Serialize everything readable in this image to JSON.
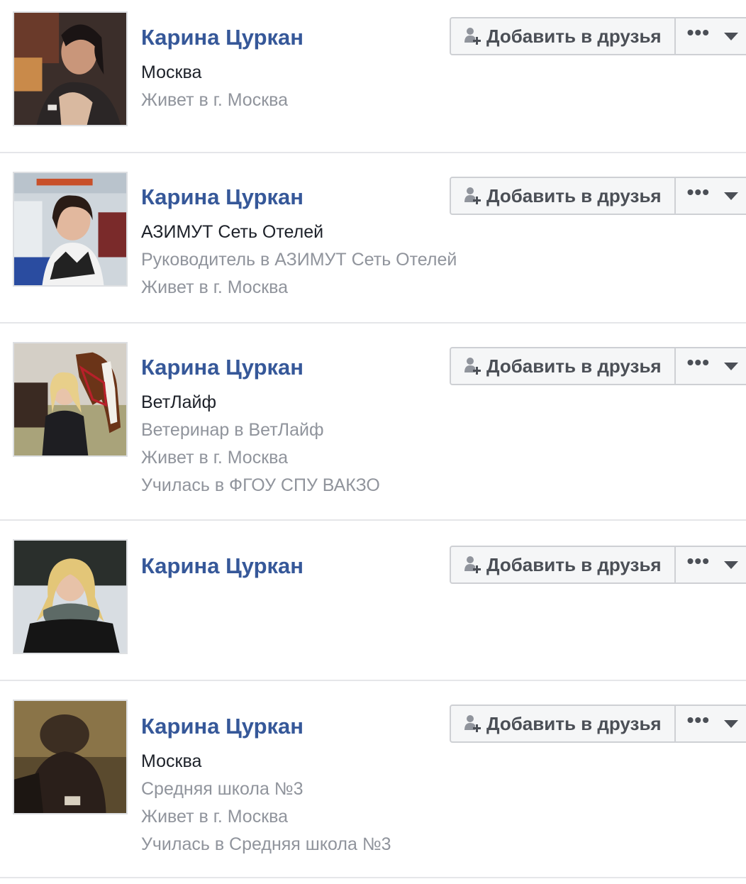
{
  "colors": {
    "name_link": "#365899",
    "primary_text": "#1d2129",
    "secondary_text": "#90949c",
    "button_bg": "#f5f6f7",
    "button_border": "#ced0d4"
  },
  "results": [
    {
      "name": "Карина Цуркан",
      "lines": [
        {
          "text": "Москва",
          "style": "primary"
        },
        {
          "text": "Живет в г. Москва",
          "style": "secondary"
        }
      ],
      "add_label": "Добавить в друзья",
      "more_icon": "more-dots-icon",
      "caret_icon": "chevron-down-icon"
    },
    {
      "name": "Карина Цуркан",
      "lines": [
        {
          "text": "АЗИМУТ Сеть Отелей",
          "style": "primary"
        },
        {
          "text": "Руководитель в АЗИМУТ Сеть Отелей",
          "style": "secondary"
        },
        {
          "text": "Живет в г. Москва",
          "style": "secondary"
        }
      ],
      "add_label": "Добавить в друзья",
      "more_icon": "more-dots-icon",
      "caret_icon": "chevron-down-icon"
    },
    {
      "name": "Карина Цуркан",
      "lines": [
        {
          "text": "ВетЛайф",
          "style": "primary"
        },
        {
          "text": "Ветеринар в ВетЛайф",
          "style": "secondary"
        },
        {
          "text": "Живет в г. Москва",
          "style": "secondary"
        },
        {
          "text": "Училась в ФГОУ СПУ ВАКЗО",
          "style": "secondary"
        }
      ],
      "add_label": "Добавить в друзья",
      "more_icon": "more-dots-icon",
      "caret_icon": "chevron-down-icon"
    },
    {
      "name": "Карина Цуркан",
      "lines": [],
      "add_label": "Добавить в друзья",
      "more_icon": "more-dots-icon",
      "caret_icon": "chevron-down-icon"
    },
    {
      "name": "Карина Цуркан",
      "lines": [
        {
          "text": "Москва",
          "style": "primary"
        },
        {
          "text": "Средняя школа №3",
          "style": "secondary"
        },
        {
          "text": "Живет в г. Москва",
          "style": "secondary"
        },
        {
          "text": "Училась в Средняя школа №3",
          "style": "secondary"
        }
      ],
      "add_label": "Добавить в друзья",
      "more_icon": "more-dots-icon",
      "caret_icon": "chevron-down-icon"
    }
  ]
}
